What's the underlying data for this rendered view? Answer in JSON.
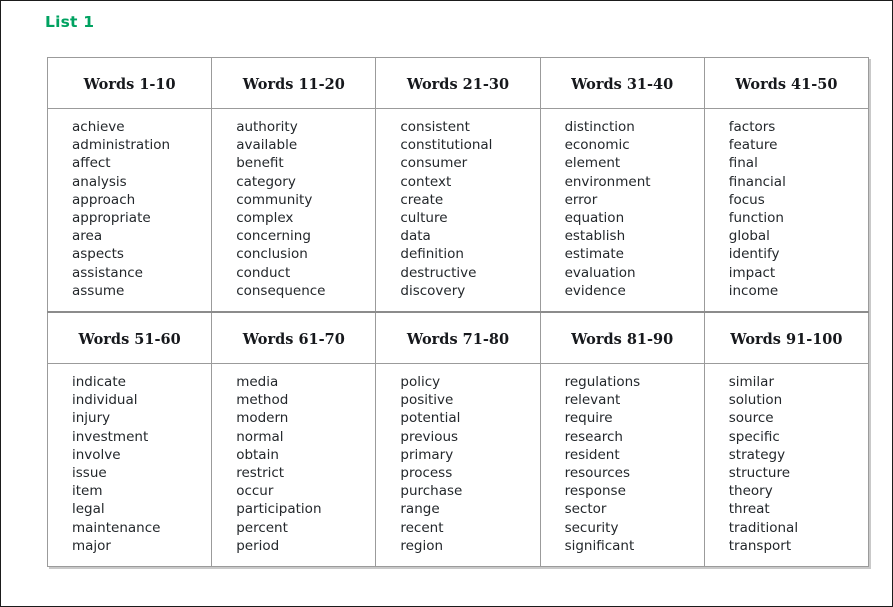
{
  "page": {
    "title": "List 1",
    "title_color": "#00a261",
    "border_color": "#1b1b1b",
    "background": "#ffffff"
  },
  "table": {
    "border_color": "#9b9b9b",
    "header_text_color": "#16181c",
    "word_text_color": "#23272b",
    "blocks": [
      {
        "headers": [
          "Words 1-10",
          "Words 11-20",
          "Words 21-30",
          "Words 31-40",
          "Words 41-50"
        ],
        "columns": [
          [
            "achieve",
            "administration",
            "affect",
            "analysis",
            "approach",
            "appropriate",
            "area",
            "aspects",
            "assistance",
            "assume"
          ],
          [
            "authority",
            "available",
            "benefit",
            "category",
            "community",
            "complex",
            "concerning",
            "conclusion",
            "conduct",
            "consequence"
          ],
          [
            "consistent",
            "constitutional",
            "consumer",
            "context",
            "create",
            "culture",
            "data",
            "definition",
            "destructive",
            "discovery"
          ],
          [
            "distinction",
            "economic",
            "element",
            "environment",
            "error",
            "equation",
            "establish",
            "estimate",
            "evaluation",
            "evidence"
          ],
          [
            "factors",
            "feature",
            "final",
            "financial",
            "focus",
            "function",
            "global",
            "identify",
            "impact",
            "income"
          ]
        ]
      },
      {
        "headers": [
          "Words 51-60",
          "Words 61-70",
          "Words 71-80",
          "Words 81-90",
          "Words 91-100"
        ],
        "columns": [
          [
            "indicate",
            "individual",
            "injury",
            "investment",
            "involve",
            "issue",
            "item",
            "legal",
            "maintenance",
            "major"
          ],
          [
            "media",
            "method",
            "modern",
            "normal",
            "obtain",
            "restrict",
            "occur",
            "participation",
            "percent",
            "period"
          ],
          [
            "policy",
            "positive",
            "potential",
            "previous",
            "primary",
            "process",
            "purchase",
            "range",
            "recent",
            "region"
          ],
          [
            "regulations",
            "relevant",
            "require",
            "research",
            "resident",
            "resources",
            "response",
            "sector",
            "security",
            "significant"
          ],
          [
            "similar",
            "solution",
            "source",
            "specific",
            "strategy",
            "structure",
            "theory",
            "threat",
            "traditional",
            "transport"
          ]
        ]
      }
    ]
  }
}
